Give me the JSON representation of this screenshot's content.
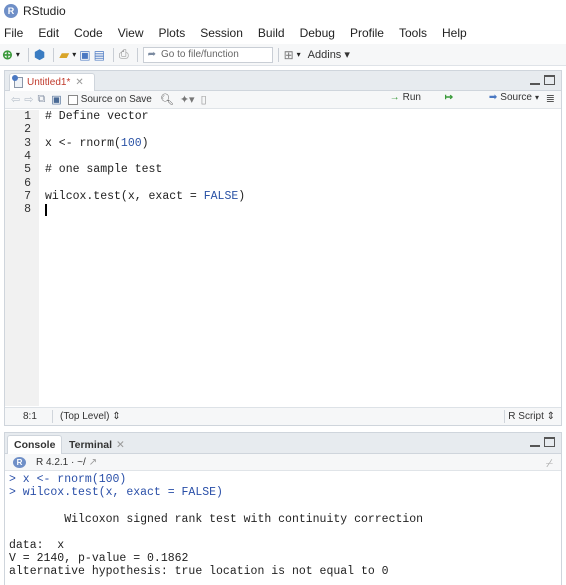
{
  "window": {
    "title": "RStudio"
  },
  "menu": [
    "File",
    "Edit",
    "Code",
    "View",
    "Plots",
    "Session",
    "Build",
    "Debug",
    "Profile",
    "Tools",
    "Help"
  ],
  "main_toolbar": {
    "goto_placeholder": "Go to file/function",
    "addins_label": "Addins ▾"
  },
  "editor": {
    "tab_label": "Untitled1*",
    "source_on_save_label": "Source on Save",
    "run_label": "Run",
    "source_label": "Source",
    "lines": [
      {
        "num": "1",
        "text": "# Define vector",
        "kind": "comment"
      },
      {
        "num": "2",
        "text": "",
        "kind": "plain"
      },
      {
        "num": "3",
        "text": "x <- rnorm(100)",
        "kind": "code"
      },
      {
        "num": "4",
        "text": "",
        "kind": "plain"
      },
      {
        "num": "5",
        "text": "# one sample test",
        "kind": "comment"
      },
      {
        "num": "6",
        "text": "",
        "kind": "plain"
      },
      {
        "num": "7",
        "text": "wilcox.test(x, exact = FALSE)",
        "kind": "code"
      },
      {
        "num": "8",
        "text": "",
        "kind": "plain"
      }
    ],
    "status": {
      "position": "8:1",
      "scope": "(Top Level) ⇕",
      "file_type": "R Script ⇕"
    }
  },
  "console": {
    "tab_console": "Console",
    "tab_terminal": "Terminal",
    "r_version": "R 4.2.1 · ~/",
    "lines": [
      {
        "text": "> x <- rnorm(100)",
        "kind": "cmd"
      },
      {
        "text": "> wilcox.test(x, exact = FALSE)",
        "kind": "cmd"
      },
      {
        "text": "",
        "kind": "out"
      },
      {
        "text": "\tWilcoxon signed rank test with continuity correction",
        "kind": "out"
      },
      {
        "text": "",
        "kind": "out"
      },
      {
        "text": "data:  x",
        "kind": "out"
      },
      {
        "text": "V = 2140, p-value = 0.1862",
        "kind": "out"
      },
      {
        "text": "alternative hypothesis: true location is not equal to 0",
        "kind": "out"
      }
    ]
  },
  "colors": {
    "comment": "#4f8f4f",
    "number": "#2a52a5",
    "tab_modified": "#c0392b",
    "console_cmd": "#2a4fa8"
  }
}
